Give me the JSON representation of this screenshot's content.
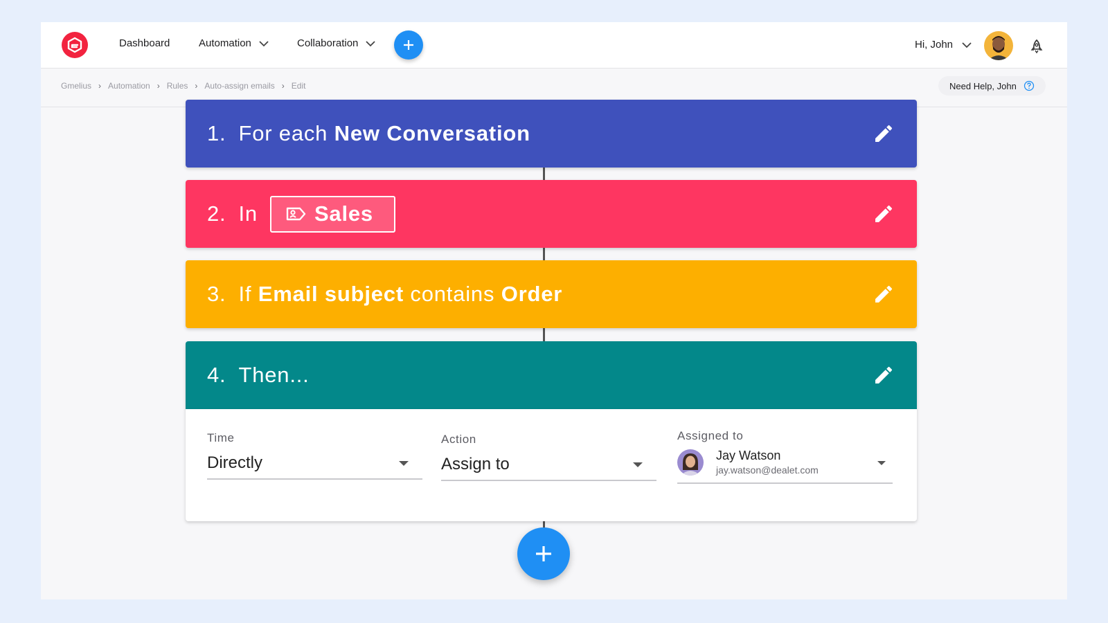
{
  "nav": {
    "dashboard": "Dashboard",
    "automation": "Automation",
    "collaboration": "Collaboration",
    "greeting": "Hi, John"
  },
  "breadcrumb": [
    "Gmelius",
    "Automation",
    "Rules",
    "Auto-assign emails",
    "Edit"
  ],
  "help": {
    "label": "Need Help, John"
  },
  "steps": {
    "s1": {
      "num": "1.",
      "text": "For each",
      "bold": "New Conversation"
    },
    "s2": {
      "num": "2.",
      "text": "In",
      "tag": "Sales"
    },
    "s3": {
      "num": "3.",
      "text1": "If",
      "bold1": "Email subject",
      "text2": "contains",
      "bold2": "Order"
    },
    "s4": {
      "num": "4.",
      "text": "Then..."
    }
  },
  "form": {
    "time": {
      "label": "Time",
      "value": "Directly"
    },
    "action": {
      "label": "Action",
      "value": "Assign to"
    },
    "assigned": {
      "label": "Assigned to",
      "name": "Jay Watson",
      "email": "jay.watson@dealet.com"
    }
  },
  "colors": {
    "step1": "#3f51bc",
    "step2": "#fe3661",
    "step3": "#fdaf00",
    "step4": "#03888a",
    "accent": "#1f8ff4",
    "logo": "#f2233f"
  },
  "icons": [
    "gmelius-logo-icon",
    "chevron-down-icon",
    "plus-icon",
    "rocket-icon",
    "help-circle-icon",
    "pencil-icon",
    "tag-icon"
  ]
}
